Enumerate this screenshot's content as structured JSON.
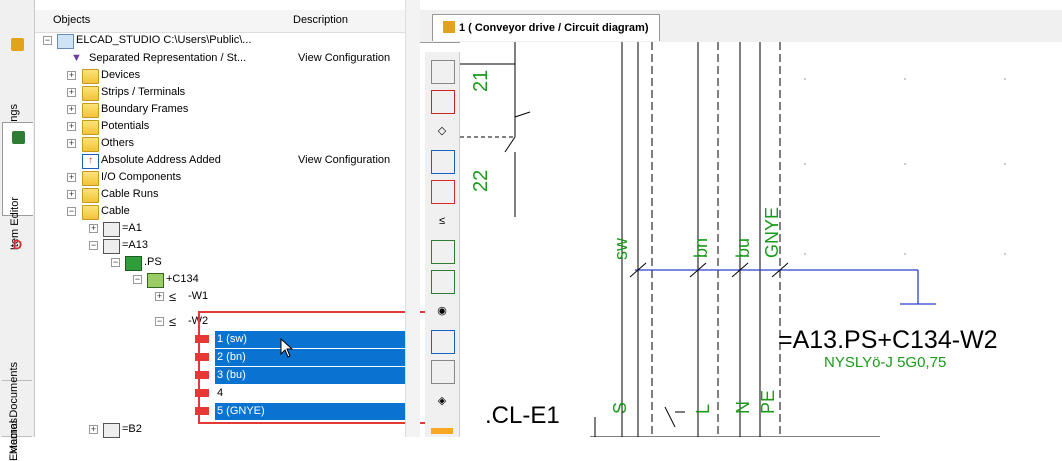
{
  "app": {
    "doc_tab": "1 ( Conveyor drive  / Circuit diagram)"
  },
  "side_tabs": [
    "Drawings",
    "Item Editor",
    "External Documents",
    "Macros"
  ],
  "tree": {
    "col_objects": "Objects",
    "col_description": "Description",
    "rows": [
      {
        "label": "ELCAD_STUDIO C:\\Users\\Public\\...",
        "desc": ""
      },
      {
        "label": "Separated Representation / St...",
        "desc": "View Configuration"
      },
      {
        "label": "Devices",
        "desc": ""
      },
      {
        "label": "Strips / Terminals",
        "desc": ""
      },
      {
        "label": "Boundary Frames",
        "desc": ""
      },
      {
        "label": "Potentials",
        "desc": ""
      },
      {
        "label": "Others",
        "desc": ""
      },
      {
        "label": "Absolute Address Added",
        "desc": "View Configuration"
      },
      {
        "label": "I/O Components",
        "desc": ""
      },
      {
        "label": "Cable Runs",
        "desc": ""
      },
      {
        "label": "Cable",
        "desc": ""
      },
      {
        "label": "=A1",
        "desc": ""
      },
      {
        "label": "=A13",
        "desc": ""
      },
      {
        "label": ".PS",
        "desc": ""
      },
      {
        "label": "+C134",
        "desc": ""
      },
      {
        "label": "-W1",
        "desc": ""
      },
      {
        "label": "-W2",
        "desc": ""
      },
      {
        "label": "1 (sw)",
        "desc": ""
      },
      {
        "label": "2 (bn)",
        "desc": ""
      },
      {
        "label": "3 (bu)",
        "desc": ""
      },
      {
        "label": "4",
        "desc": ""
      },
      {
        "label": "5 (GNYE)",
        "desc": ""
      },
      {
        "label": "=B2",
        "desc": ""
      }
    ]
  },
  "drawing": {
    "contact_top": "21",
    "contact_bottom": "22",
    "wire_labels": [
      "sw",
      "bn",
      "bu",
      "GNYE"
    ],
    "cable_tag": "=A13.PS+C134-W2",
    "cable_type": "NYSLYö-J 5G0,75",
    "terminal_labels": [
      "S",
      "L",
      "N",
      "PE"
    ],
    "component": ".CL-E1"
  },
  "colors": {
    "selection": "#0a73d2",
    "highlight_box": "#e53935",
    "wire_blue": "#2a3fd0",
    "label_green": "#1a9a1a"
  }
}
